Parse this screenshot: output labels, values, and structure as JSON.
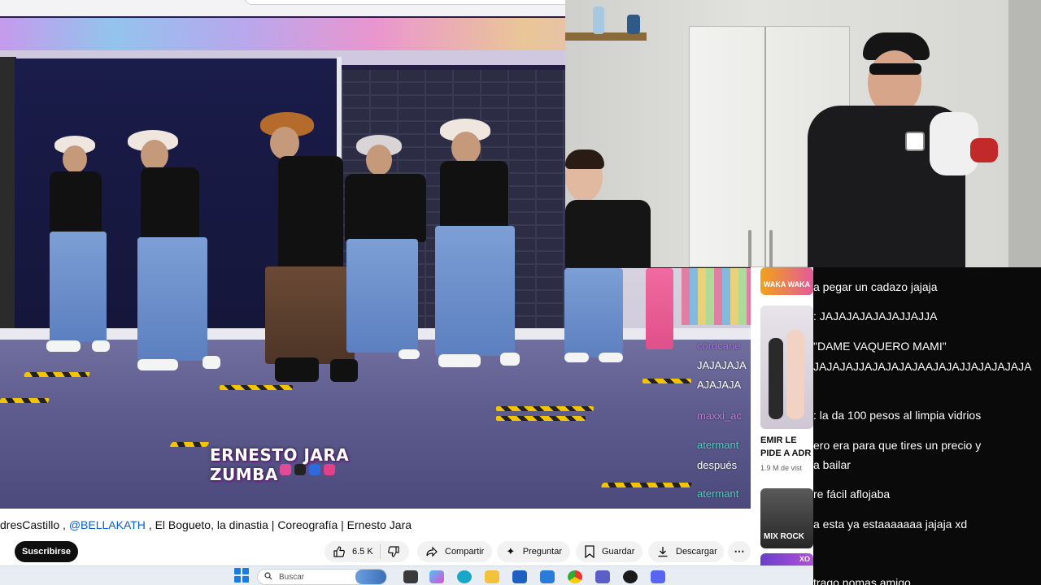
{
  "video": {
    "watermark": "ERNESTO JARA ZUMBA",
    "overlay_chat": [
      {
        "user": "maxxi_ac",
        "text": "",
        "color": "#c07bd6"
      },
      {
        "user": "cordcane",
        "text": "",
        "color": "#a06fe0"
      },
      {
        "user": "",
        "text": "JAJAJAJA",
        "color": "#ffffff"
      },
      {
        "user": "",
        "text": "AJAJAJA",
        "color": "#ffffff"
      },
      {
        "user": "maxxi_ac",
        "text": "",
        "color": "#c07bd6"
      },
      {
        "user": "atermant",
        "text": "",
        "color": "#4fd1c5"
      },
      {
        "user": "",
        "text": "después",
        "color": "#ffffff"
      },
      {
        "user": "atermant",
        "text": "",
        "color": "#4fd1c5"
      }
    ]
  },
  "title": {
    "prefix": "dresCastillo",
    "sep1": " , ",
    "mention": "@BELLAKATH",
    "rest": " , El Bogueto, la dinastia | Coreografía | Ernesto Jara"
  },
  "actions": {
    "subscribe": "Suscribirse",
    "likes": "6.5 K",
    "share": "Compartir",
    "ask": "Preguntar",
    "save": "Guardar",
    "download": "Descargar"
  },
  "suggested": [
    {
      "badge": "WAKA WAKA"
    },
    {
      "title_l1": "EMIR LE",
      "title_l2": "PIDE A ADR",
      "meta": "1.9 M de vist"
    },
    {
      "badge": "MIX ROCK"
    },
    {
      "badge": "XO"
    }
  ],
  "chat": [
    "a pegar un cadazo jajaja",
    ": JAJAJAJAJAJAJJAJJA",
    "\"DAME VAQUERO MAMI\"",
    "JAJAJAJJAJAJAJAJAAJAJAJJAJAJAJAJA",
    ": la da 100 pesos al limpia vidrios",
    "ero era para que tires un precio y",
    "a bailar",
    "re fácil aflojaba",
    "a esta ya estaaaaaaa jajaja xd",
    "trago nomas amigo"
  ],
  "taskbar": {
    "search_placeholder": "Buscar"
  },
  "colors": {
    "link": "#065fd4",
    "chat_bg": "#0a0a0a",
    "subscribe_bg": "#0f0f0f"
  }
}
